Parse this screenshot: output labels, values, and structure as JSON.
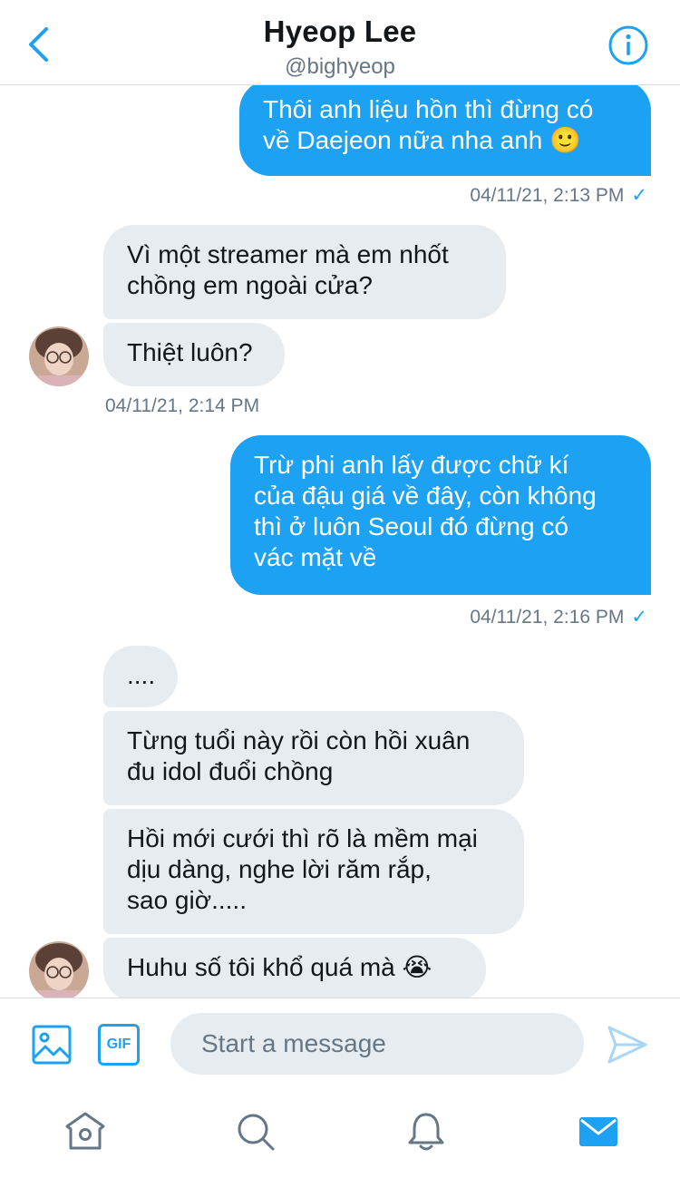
{
  "header": {
    "title": "Hyeop Lee",
    "handle": "@bighyeop"
  },
  "messages": [
    {
      "id": "m1",
      "direction": "outgoing",
      "lines": [
        "Thôi anh liệu hồn thì đừng có",
        "về Daejeon nữa nha anh 🙂"
      ]
    },
    {
      "id": "t1",
      "type": "timestamp",
      "text": "04/11/21, 2:13 PM",
      "read": true
    },
    {
      "id": "m2",
      "direction": "incoming",
      "lines": [
        "Vì một streamer mà em nhốt",
        "chồng em ngoài cửa?"
      ]
    },
    {
      "id": "m3",
      "direction": "incoming",
      "lines": [
        "Thiệt luôn?"
      ]
    },
    {
      "id": "t2",
      "type": "timestamp",
      "text": "04/11/21, 2:14 PM"
    },
    {
      "id": "m4",
      "direction": "outgoing",
      "lines": [
        "Trừ phi anh lấy được chữ kí",
        "của đậu giá về đây, còn không",
        "thì ở luôn Seoul đó đừng có",
        "vác mặt về"
      ]
    },
    {
      "id": "t3",
      "type": "timestamp",
      "text": "04/11/21, 2:16 PM",
      "read": true
    },
    {
      "id": "m5",
      "direction": "incoming",
      "lines": [
        "...."
      ]
    },
    {
      "id": "m6",
      "direction": "incoming",
      "lines": [
        "Từng tuổi này rồi còn hồi xuân",
        "đu idol đuổi chồng"
      ]
    },
    {
      "id": "m7",
      "direction": "incoming",
      "lines": [
        "Hồi mới cưới thì rõ là mềm mại",
        "dịu dàng, nghe lời răm rắp,",
        "sao giờ....."
      ]
    },
    {
      "id": "m8",
      "direction": "incoming",
      "lines": [
        "Huhu số tôi khổ quá mà 😭"
      ]
    }
  ],
  "read_check": "✓",
  "composer": {
    "placeholder": "Start a message",
    "gif_label": "GIF"
  },
  "tabs": [
    "home",
    "search",
    "notifications",
    "messages"
  ],
  "colors": {
    "accent": "#1da1f2",
    "incoming_bubble": "#e6ecf0",
    "secondary_text": "#657786"
  }
}
